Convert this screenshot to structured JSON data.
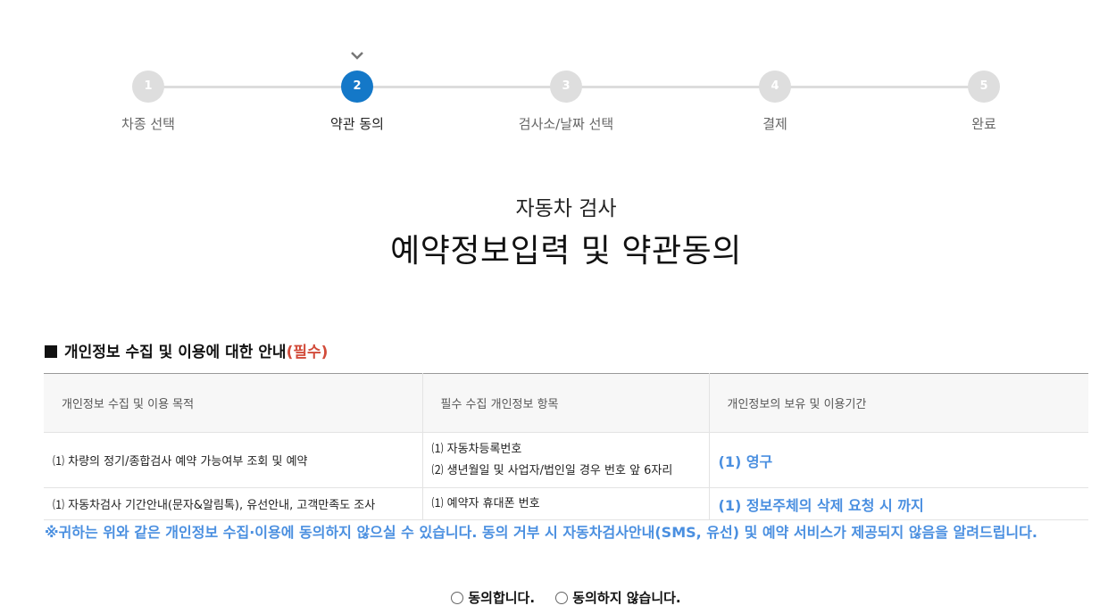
{
  "steps": [
    {
      "num": "1",
      "label": "차종 선택"
    },
    {
      "num": "2",
      "label": "약관 동의"
    },
    {
      "num": "3",
      "label": "검사소/날짜 선택"
    },
    {
      "num": "4",
      "label": "결제"
    },
    {
      "num": "5",
      "label": "완료"
    }
  ],
  "current_step_index": 1,
  "colors": {
    "active": "#1478c8",
    "inactive": "#dedede",
    "required": "#d24b3a",
    "notice": "#4a8fe0"
  },
  "header": {
    "subtitle": "자동차 검사",
    "title": "예약정보입력 및 약관동의"
  },
  "section": {
    "heading": "개인정보 수집 및 이용에 대한 안내",
    "required": "(필수)"
  },
  "table": {
    "headers": [
      "개인정보 수집 및 이용 목적",
      "필수 수집 개인정보 항목",
      "개인정보의 보유 및 이용기간"
    ],
    "rows": [
      {
        "purpose": "⑴ 차량의 정기/종합검사 예약 가능여부 조회 및 예약",
        "items": [
          "⑴ 자동차등록번호",
          "⑵ 생년월일 및 사업자/법인일 경우 번호 앞 6자리"
        ],
        "period": "(1) 영구"
      },
      {
        "purpose": "⑴ 자동차검사 기간안내(문자&알림톡), 유선안내, 고객만족도 조사",
        "items": [
          "⑴ 예약자 휴대폰 번호"
        ],
        "period": "(1) 정보주체의 삭제 요청 시 까지"
      }
    ]
  },
  "notice": "※귀하는 위와 같은 개인정보 수집·이용에 동의하지 않으실 수 있습니다. 동의 거부 시 자동차검사안내(SMS, 유선) 및 예약 서비스가 제공되지 않음을 알려드립니다.",
  "agreement": {
    "agree": "동의합니다.",
    "disagree": "동의하지 않습니다."
  }
}
